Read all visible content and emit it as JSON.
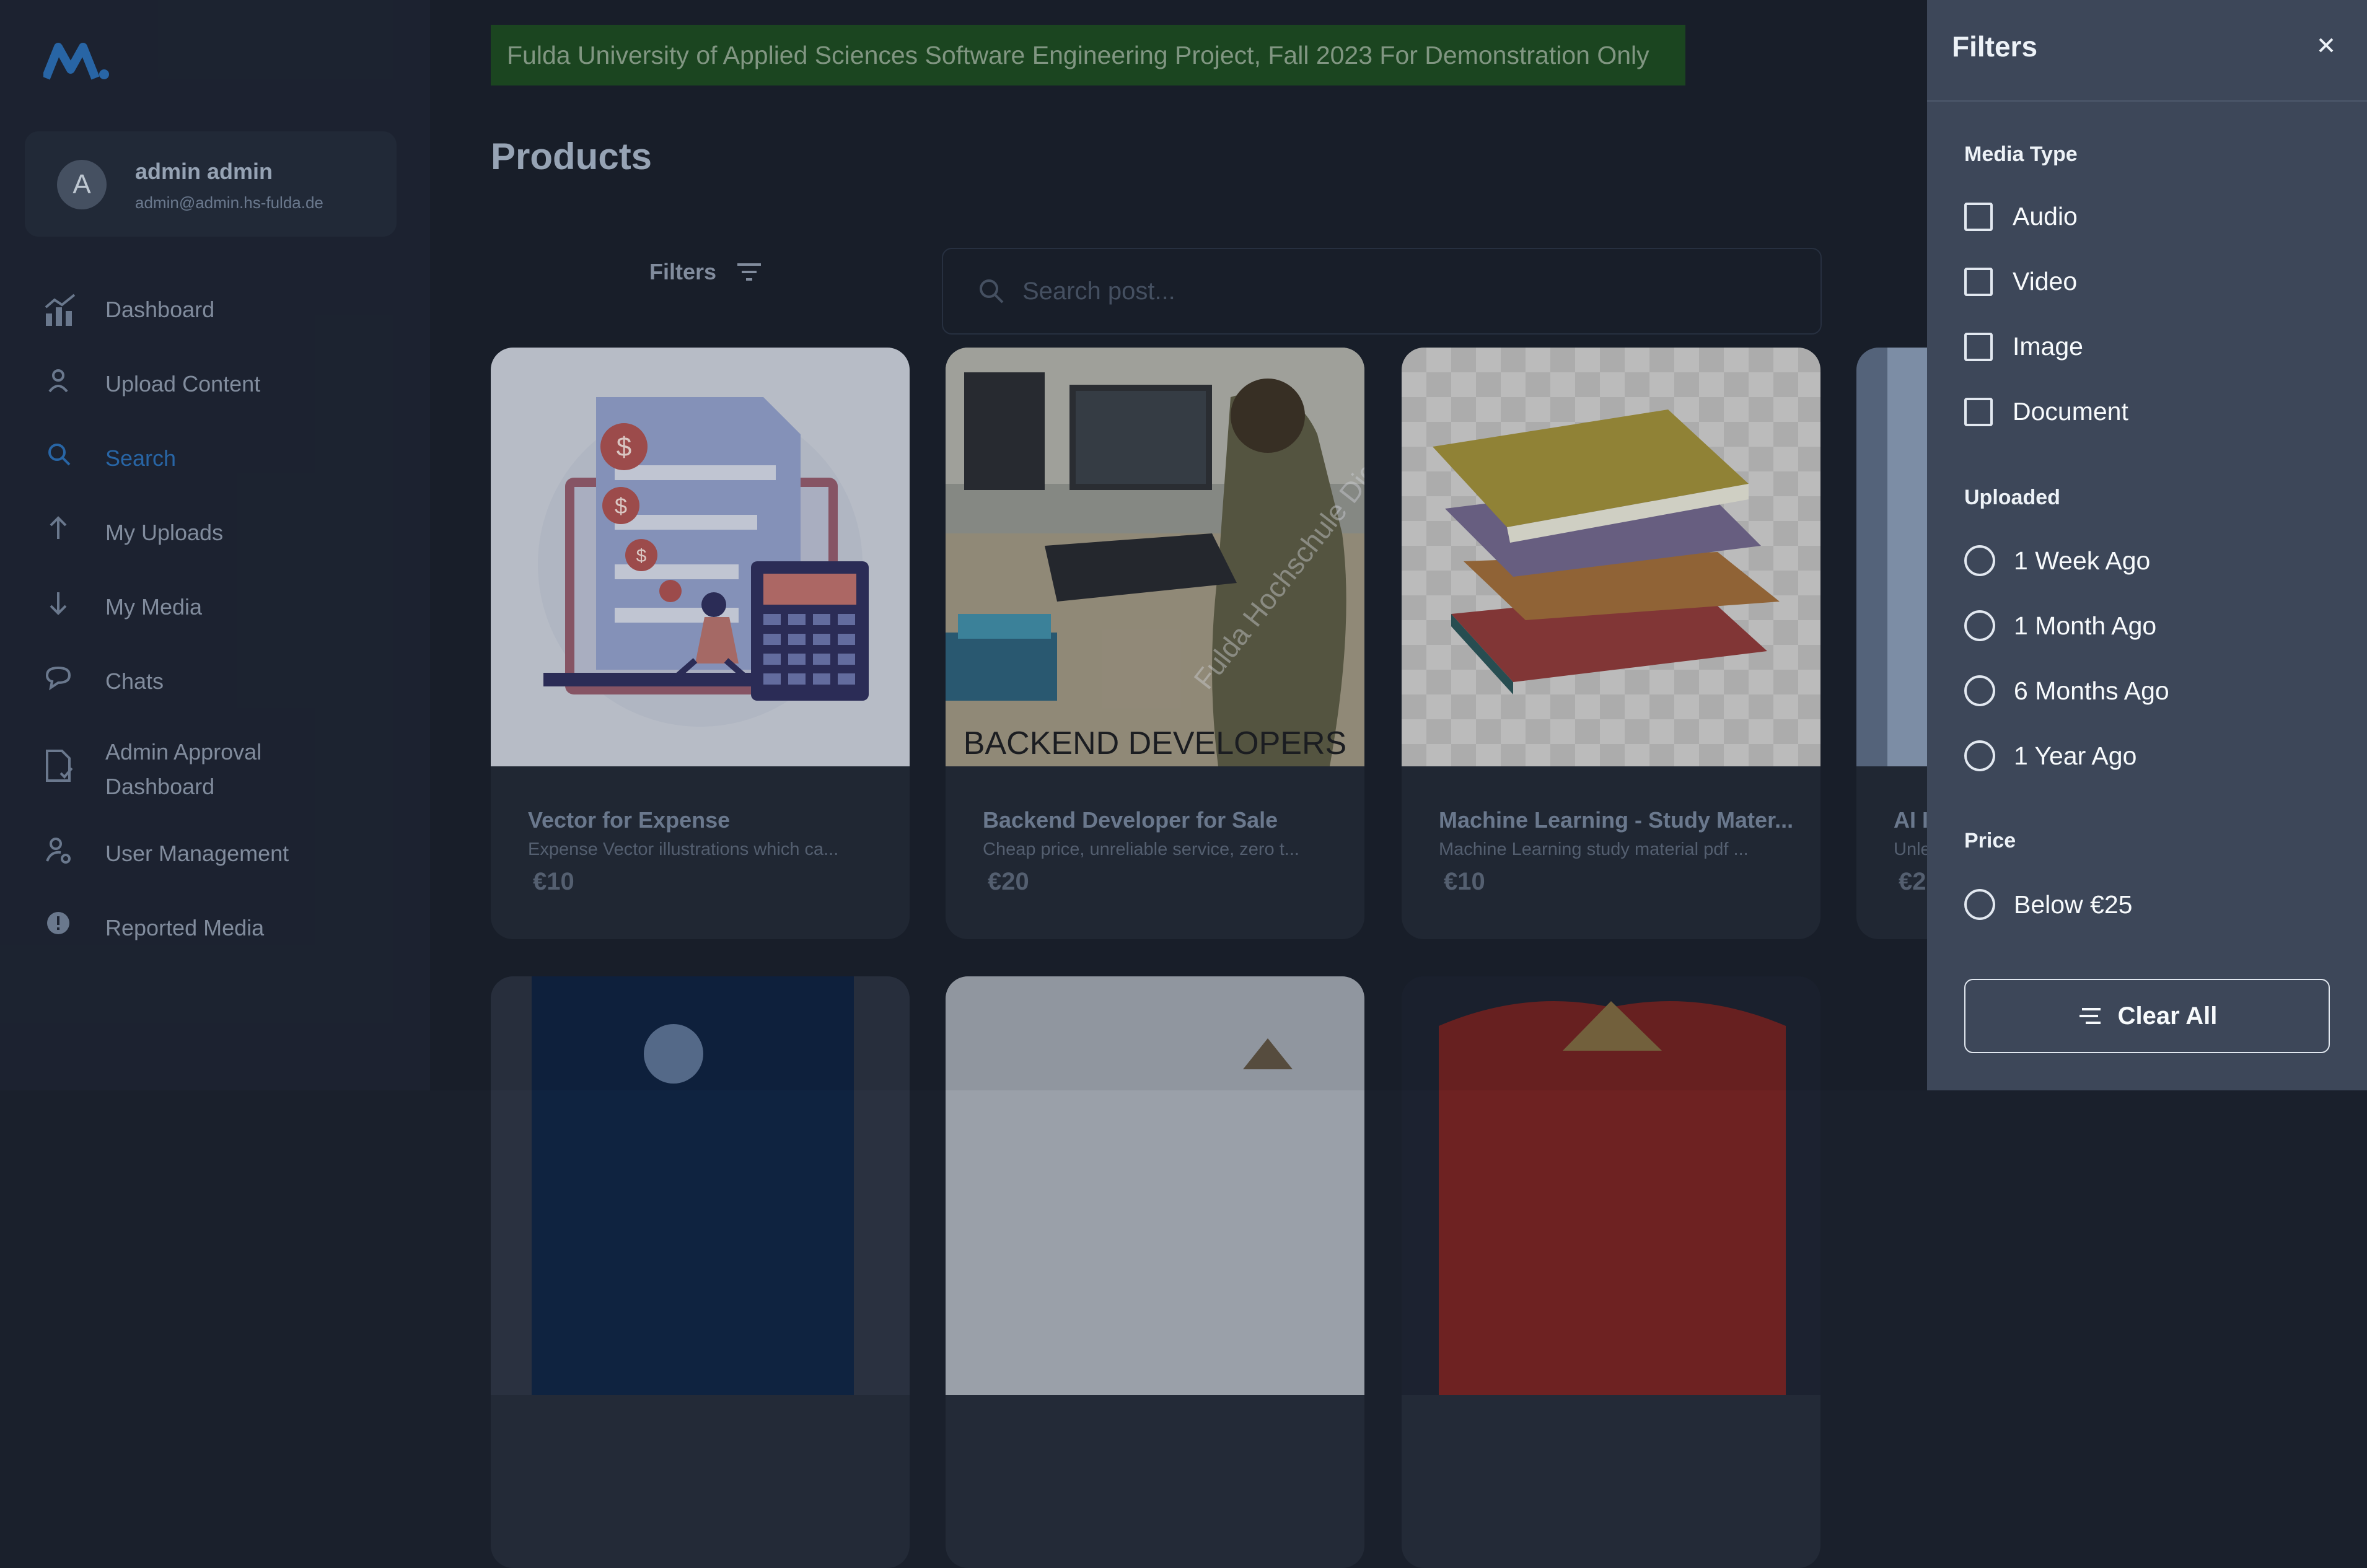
{
  "sidebar": {
    "user": {
      "initial": "A",
      "name": "admin admin",
      "email": "admin@admin.hs-fulda.de"
    },
    "items": [
      {
        "label": "Dashboard",
        "icon": "chart-icon"
      },
      {
        "label": "Upload Content",
        "icon": "person-icon"
      },
      {
        "label": "Search",
        "icon": "search-icon",
        "active": true
      },
      {
        "label": "My Uploads",
        "icon": "arrow-up-icon"
      },
      {
        "label": "My Media",
        "icon": "arrow-down-icon"
      },
      {
        "label": "Chats",
        "icon": "chat-bubble-icon"
      },
      {
        "label": "Admin Approval Dashboard",
        "icon": "document-check-icon"
      },
      {
        "label": "User Management",
        "icon": "user-settings-icon"
      },
      {
        "label": "Reported Media",
        "icon": "alert-icon"
      }
    ]
  },
  "main": {
    "banner": "Fulda University of Applied Sciences Software Engineering Project, Fall 2023 For Demonstration Only",
    "title": "Products",
    "filters_label": "Filters",
    "search_placeholder": "Search post...",
    "cards": [
      {
        "title": "Vector for Expense",
        "desc": "Expense Vector illustrations which ca...",
        "price": "€10"
      },
      {
        "title": "Backend Developer for Sale",
        "desc": "Cheap price, unreliable service, zero t...",
        "price": "€20",
        "image_text": "BACKEND DEVELOPERS",
        "watermark": "Fulda Hochschule Digital Bibli"
      },
      {
        "title": "Machine Learning - Study Mater...",
        "desc": "Machine Learning study material pdf ...",
        "price": "€10"
      },
      {
        "title": "AI I",
        "desc": "Unle",
        "price": "€2"
      }
    ]
  },
  "drawer": {
    "title": "Filters",
    "media_type": {
      "title": "Media Type",
      "options": [
        "Audio",
        "Video",
        "Image",
        "Document"
      ]
    },
    "uploaded": {
      "title": "Uploaded",
      "options": [
        "1 Week Ago",
        "1 Month Ago",
        "6 Months Ago",
        "1 Year Ago"
      ]
    },
    "price": {
      "title": "Price",
      "options": [
        "Below €25"
      ]
    },
    "clear_label": "Clear All"
  },
  "colors": {
    "accent": "#2b6cb0",
    "banner_bg": "#1d4a22",
    "drawer_bg": "#3d4759"
  }
}
